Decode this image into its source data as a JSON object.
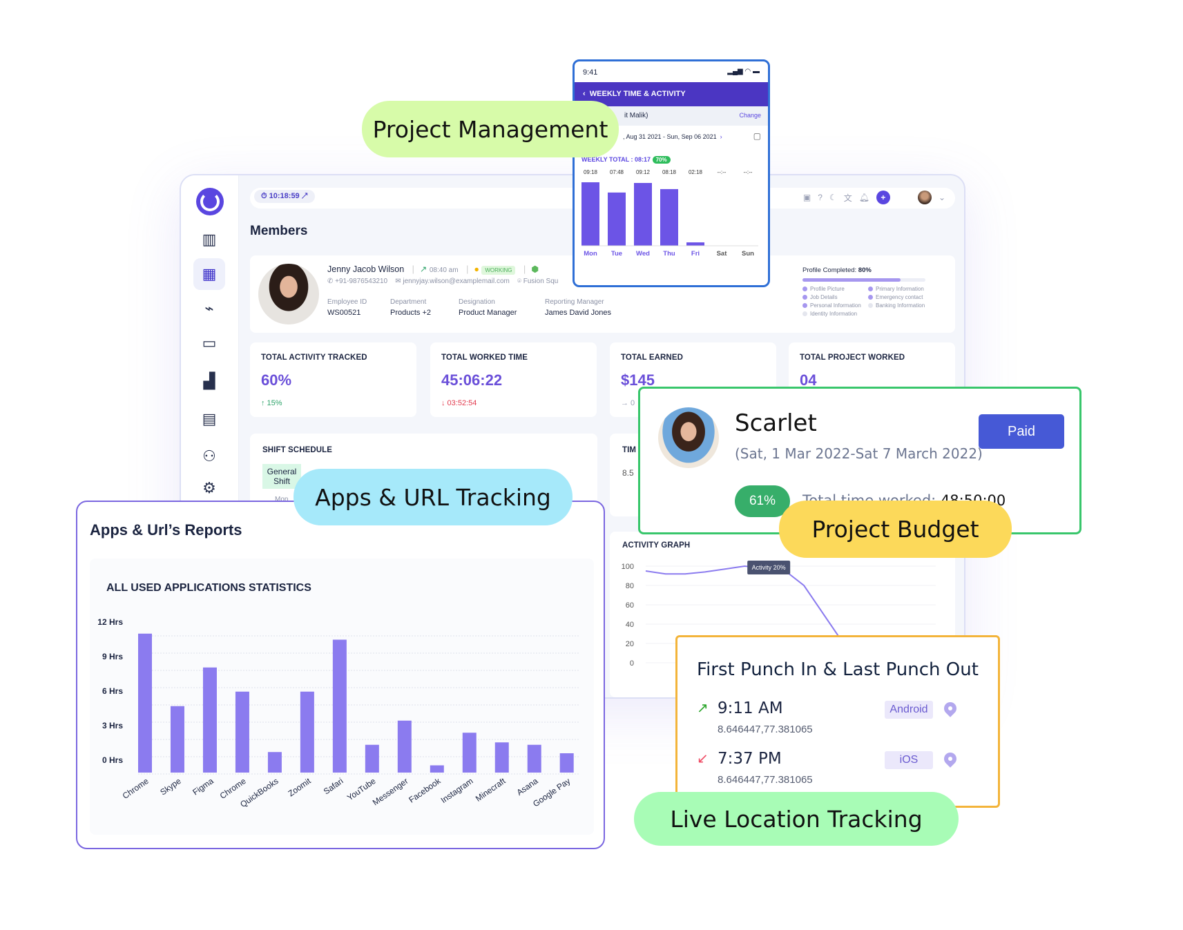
{
  "labels": {
    "project_management": "Project Management",
    "apps_tracking": "Apps & URL Tracking",
    "project_budget": "Project Budget",
    "live_location": "Live Location Tracking"
  },
  "dashboard": {
    "timer": "10:18:59",
    "page_title": "Members",
    "sidebar_icons": [
      "dashboard-icon",
      "calendar-icon",
      "analytics-icon",
      "folder-icon",
      "building-icon",
      "document-icon",
      "team-icon",
      "settings-icon"
    ],
    "member": {
      "name": "Jenny Jacob Wilson",
      "punch_time": "08:40 am",
      "status": "WORKING",
      "phone": "+91-9876543210",
      "email": "jennyjay.wilson@examplemail.com",
      "location": "Fusion Squ",
      "fields": [
        {
          "label": "Employee ID",
          "value": "WS00521"
        },
        {
          "label": "Department",
          "value": "Products +2"
        },
        {
          "label": "Designation",
          "value": "Product Manager"
        },
        {
          "label": "Reporting Manager",
          "value": "James David Jones"
        }
      ]
    },
    "profile": {
      "label": "Profile Completed:",
      "value": "80%",
      "progress": 0.8,
      "items": [
        {
          "label": "Profile Picture",
          "done": true
        },
        {
          "label": "Primary Information",
          "done": true
        },
        {
          "label": "Job Details",
          "done": true
        },
        {
          "label": "Emergency contact",
          "done": true
        },
        {
          "label": "Personal Information",
          "done": true
        },
        {
          "label": "Banking Information",
          "done": false
        },
        {
          "label": "Identity Information",
          "done": false
        }
      ]
    },
    "stats": [
      {
        "title": "TOTAL ACTIVITY TRACKED",
        "value": "60%",
        "sub": "↑ 15%",
        "sub_color": "#2ea36a"
      },
      {
        "title": "TOTAL WORKED TIME",
        "value": "45:06:22",
        "sub": "↓ 03:52:54",
        "sub_color": "#e23b4e"
      },
      {
        "title": "TOTAL EARNED",
        "value": "$145",
        "sub": "→ 0",
        "sub_color": "#9aa0b5"
      },
      {
        "title": "TOTAL PROJECT WORKED",
        "value": "04",
        "sub": "",
        "sub_color": "#9aa0b5"
      }
    ],
    "shift": {
      "title": "SHIFT SCHEDULE",
      "badge": "General Shift",
      "day": "Mon"
    },
    "time_card": {
      "title": "TIM",
      "value": "8.5"
    },
    "activity_graph": {
      "title": "ACTIVITY GRAPH",
      "tooltip": "Activity 20%"
    }
  },
  "phone": {
    "time": "9:41",
    "header": "WEEKLY TIME & ACTIVITY",
    "user": "it Malik)",
    "change": "Change",
    "range": ", Aug 31 2021 - Sun, Sep 06 2021",
    "weekly_total_label": "WEEKLY TOTAL :",
    "weekly_total": "08:17",
    "weekly_badge": "70%"
  },
  "scarlet": {
    "name": "Scarlet",
    "range": "(Sat, 1 Mar 2022-Sat 7 March 2022)",
    "button": "Paid",
    "percent": "61%",
    "worked_label": "Total time worked:",
    "worked_value": "48:50:00"
  },
  "punch": {
    "title": "First Punch In & Last Punch Out",
    "entries": [
      {
        "time": "9:11 AM",
        "coords": "8.646447,77.381065",
        "device": "Android",
        "direction": "in"
      },
      {
        "time": "7:37 PM",
        "coords": "8.646447,77.381065",
        "device": "iOS",
        "direction": "out"
      }
    ]
  },
  "apps": {
    "title": "Apps & Url’s Reports"
  },
  "colors": {
    "accent": "#5a46e0",
    "bar": "#8b7bef",
    "green": "#38c66b",
    "orange": "#f3b43a"
  },
  "chart_data": [
    {
      "type": "bar",
      "title": "ALL USED APPLICATIONS STATISTICS",
      "xlabel": "",
      "ylabel": "",
      "categories": [
        "Chrome",
        "Skype",
        "Figma",
        "Chrome",
        "QuickBooks",
        "Zoomit",
        "Safari",
        "YouTube",
        "Messenger",
        "Facebook",
        "Instagram",
        "Minecraft",
        "Asana",
        "Google Pay"
      ],
      "values": [
        11.5,
        5.5,
        8.7,
        6.7,
        1.7,
        6.7,
        11,
        2.3,
        4.3,
        0.6,
        3.3,
        2.5,
        2.3,
        1.6
      ],
      "yticks": [
        "0 Hrs",
        "3 Hrs",
        "6 Hrs",
        "9 Hrs",
        "12 Hrs"
      ],
      "ylim": [
        0,
        12
      ],
      "grid": true
    },
    {
      "type": "bar",
      "title": "",
      "categories": [
        "Mon",
        "Tue",
        "Wed",
        "Thu",
        "Fri",
        "Sat",
        "Sun"
      ],
      "labels": [
        "09:18",
        "07:48",
        "09:12",
        "08:18",
        "02:18",
        "--:--",
        "--:--"
      ],
      "values": [
        9.3,
        7.8,
        9.2,
        8.3,
        0.5,
        0,
        0
      ]
    },
    {
      "type": "line",
      "title": "ACTIVITY GRAPH",
      "yticks": [
        "0",
        "20",
        "40",
        "60",
        "80",
        "100"
      ],
      "ylim": [
        0,
        100
      ],
      "values": [
        95,
        92,
        92,
        94,
        97,
        100,
        98,
        96,
        80,
        50,
        20,
        0
      ]
    }
  ]
}
